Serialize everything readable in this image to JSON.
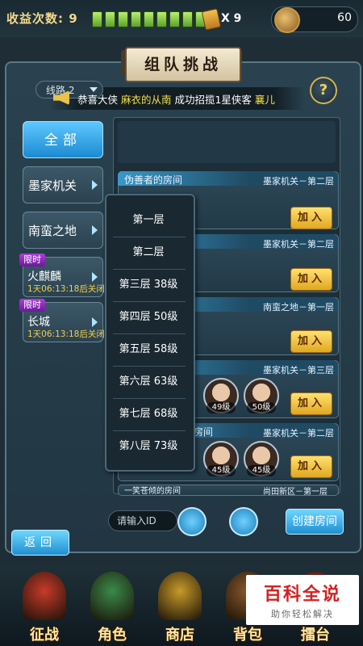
{
  "topbar": {
    "income_label": "收益次数: 9",
    "energy_filled": 9,
    "energy_total": 10,
    "ticket_count": "X 9",
    "currency_value": "60"
  },
  "title": "组队挑战",
  "line_select": "线路 2",
  "banner": {
    "seg1": "恭喜大侠 ",
    "seg2": "麻衣的从南",
    "seg3": " 成功招揽1星侠客 ",
    "seg4": "襄儿"
  },
  "help_label": "?",
  "categories": [
    {
      "label": "全部"
    },
    {
      "label": "墨家机关"
    },
    {
      "label": "南蛮之地"
    }
  ],
  "limited": [
    {
      "badge": "限时",
      "name": "火麒麟",
      "timer": "1天06:13:18后关闭"
    },
    {
      "badge": "限时",
      "name": "长城",
      "timer": "1天06:13:18后关闭"
    }
  ],
  "rooms": [
    {
      "name": "伪善者的房间",
      "floor": "墨家机关－第二层",
      "join": "加入"
    },
    {
      "name": "",
      "floor": "墨家机关－第二层",
      "join": "加入"
    },
    {
      "name": "",
      "floor": "南蛮之地－第一层",
      "join": "加入"
    },
    {
      "name": "",
      "floor": "墨家机关－第三层",
      "join": "加入",
      "levels": [
        "49级",
        "50级"
      ]
    },
    {
      "name": "房间",
      "floor": "墨家机关－第二层",
      "join": "加入",
      "levels": [
        "45级",
        "45级"
      ]
    },
    {
      "name": "一笑苍倾的房间",
      "floor": "尚田新区－第一层"
    }
  ],
  "dropdown": [
    "第一层",
    "第二层",
    "第三层   38级",
    "第四层   50级",
    "第五层   58级",
    "第六层   63级",
    "第七层   68级",
    "第八层   73级"
  ],
  "search": {
    "placeholder": "请输入ID"
  },
  "create_room": "创建房间",
  "back": "返回",
  "nav": [
    {
      "label": "征战",
      "color": "#c83a2a"
    },
    {
      "label": "角色",
      "color": "#3a8a4a"
    },
    {
      "label": "商店",
      "color": "#c89a2a"
    },
    {
      "label": "背包",
      "color": "#8a5a2a"
    },
    {
      "label": "擂台",
      "color": "#a8322a"
    }
  ],
  "watermark": {
    "main": "百科全说",
    "sub": "助你轻松解决"
  }
}
